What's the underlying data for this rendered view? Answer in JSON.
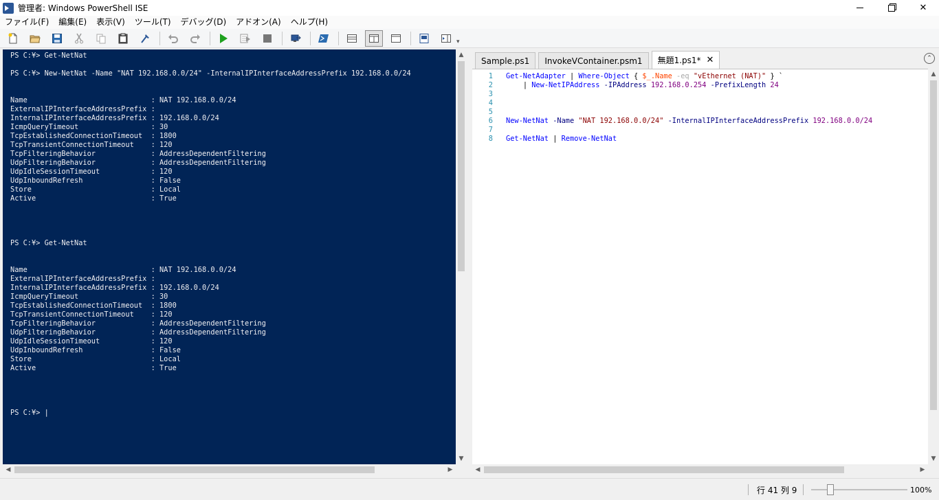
{
  "window": {
    "title": "管理者: Windows PowerShell ISE"
  },
  "menu": {
    "items": [
      "ファイル(F)",
      "編集(E)",
      "表示(V)",
      "ツール(T)",
      "デバッグ(D)",
      "アドオン(A)",
      "ヘルプ(H)"
    ]
  },
  "toolbar": {
    "icons": [
      "new-file-icon",
      "open-folder-icon",
      "save-icon",
      "cut-icon",
      "copy-icon",
      "paste-icon",
      "clear-console-icon",
      "undo-icon",
      "redo-icon",
      "run-script-icon",
      "run-selection-icon",
      "stop-icon",
      "remote-powershell-icon",
      "powershell-console-icon",
      "show-script-top-icon",
      "show-script-right-icon",
      "show-script-maximized-icon",
      "show-command-window-icon",
      "show-command-addon-icon"
    ]
  },
  "console": {
    "text": "PS C:¥> Get-NetNat\n\nPS C:¥> New-NetNat -Name \"NAT 192.168.0.0/24\" -InternalIPInterfaceAddressPrefix 192.168.0.0/24\n\n\nName                             : NAT 192.168.0.0/24\nExternalIPInterfaceAddressPrefix :\nInternalIPInterfaceAddressPrefix : 192.168.0.0/24\nIcmpQueryTimeout                 : 30\nTcpEstablishedConnectionTimeout  : 1800\nTcpTransientConnectionTimeout    : 120\nTcpFilteringBehavior             : AddressDependentFiltering\nUdpFilteringBehavior             : AddressDependentFiltering\nUdpIdleSessionTimeout            : 120\nUdpInboundRefresh                : False\nStore                            : Local\nActive                           : True\n\n\n\n\nPS C:¥> Get-NetNat\n\n\nName                             : NAT 192.168.0.0/24\nExternalIPInterfaceAddressPrefix :\nInternalIPInterfaceAddressPrefix : 192.168.0.0/24\nIcmpQueryTimeout                 : 30\nTcpEstablishedConnectionTimeout  : 1800\nTcpTransientConnectionTimeout    : 120\nTcpFilteringBehavior             : AddressDependentFiltering\nUdpFilteringBehavior             : AddressDependentFiltering\nUdpIdleSessionTimeout            : 120\nUdpInboundRefresh                : False\nStore                            : Local\nActive                           : True\n\n\n\n\nPS C:¥> |"
  },
  "editor": {
    "tabs": [
      {
        "label": "Sample.ps1"
      },
      {
        "label": "InvokeVContainer.psm1"
      },
      {
        "label": "無題1.ps1*"
      }
    ],
    "active_tab_close": "✕",
    "lines": [
      {
        "num": "1",
        "code": "Get-NetAdapter | Where-Object { $_.Name -eq \"vEthernet (NAT)\" } `"
      },
      {
        "num": "2",
        "code": "    | New-NetIPAddress -IPAddress 192.168.0.254 -PrefixLength 24"
      },
      {
        "num": "3",
        "code": ""
      },
      {
        "num": "4",
        "code": ""
      },
      {
        "num": "5",
        "code": ""
      },
      {
        "num": "6",
        "code": "New-NetNat -Name \"NAT 192.168.0.0/24\" -InternalIPInterfaceAddressPrefix 192.168.0.0/24"
      },
      {
        "num": "7",
        "code": ""
      },
      {
        "num": "8",
        "code": "Get-NetNat | Remove-NetNat"
      }
    ]
  },
  "status": {
    "position": "行 41 列 9",
    "zoom": "100%"
  },
  "colors": {
    "console_bg": "#012456",
    "console_fg": "#eeedf0",
    "line_number": "#2b91af",
    "command": "#0000ff",
    "string": "#8b0000",
    "number": "#800080",
    "parameter": "#000080",
    "operator": "#a9a9a9"
  }
}
